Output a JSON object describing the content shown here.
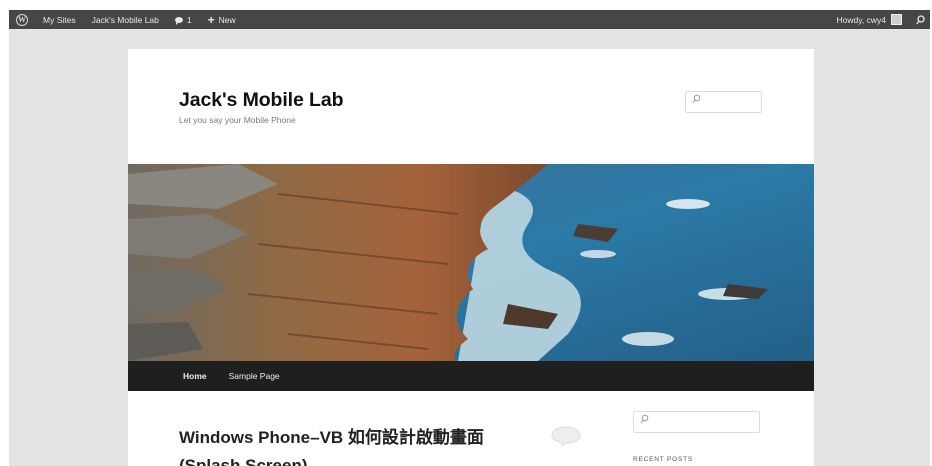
{
  "adminbar": {
    "wp_logo_letter": "W",
    "my_sites": "My Sites",
    "site_name": "Jack's Mobile Lab",
    "comments_count": "1",
    "new_label": "New",
    "new_symbol": "+",
    "howdy": "Howdy, cwy4"
  },
  "header": {
    "site_title": "Jack's Mobile Lab",
    "site_description": "Let you say your Mobile Phone",
    "search_icon": "search-icon"
  },
  "nav": {
    "items": [
      {
        "label": "Home"
      },
      {
        "label": "Sample Page"
      }
    ]
  },
  "post": {
    "title": "Windows Phone–VB 如何設計啟動畫面 (Splash Screen)"
  },
  "sidebar": {
    "recent_posts_heading": "RECENT POSTS"
  },
  "colors": {
    "adminbar_bg": "#464646",
    "frame_bg": "#e4e4e4",
    "nav_bg": "#1f1f1f",
    "title_text": "#111111"
  }
}
